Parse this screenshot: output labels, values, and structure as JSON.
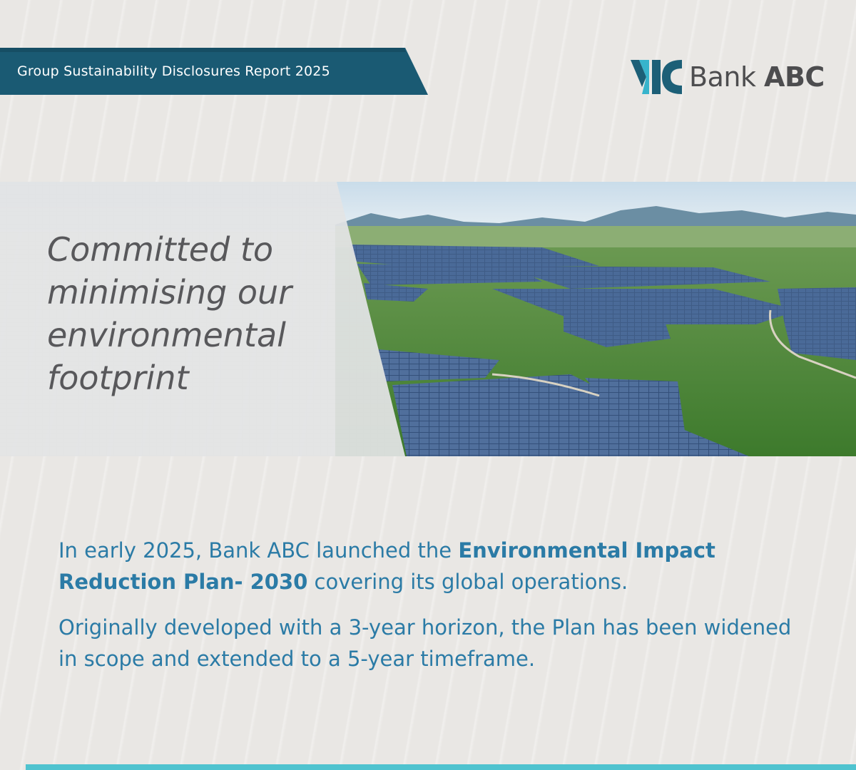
{
  "header": {
    "report_title": "Group Sustainability Disclosures Report 2025",
    "banner_color": "#1a5a73",
    "accent_color": "#3aaec1"
  },
  "logo": {
    "word_bank": "Bank",
    "word_abc": "ABC",
    "mark_color_dark": "#1c5f77",
    "mark_color_light": "#37b4cc"
  },
  "hero": {
    "heading": "Committed to minimising our environmental footprint",
    "image_icon": "solar-farm-photo"
  },
  "body": {
    "paragraph1_part1": "In early 2025, Bank ABC launched the ",
    "paragraph1_bold": "Environmental Impact Reduction Plan- 2030",
    "paragraph1_part2": " covering its global operations.",
    "paragraph2": "Originally developed with a 3-year horizon, the Plan has been widened in scope and extended to a 5-year timeframe.",
    "text_color": "#2b7ba6"
  },
  "footer": {
    "bar_color": "#4fc3cf"
  }
}
